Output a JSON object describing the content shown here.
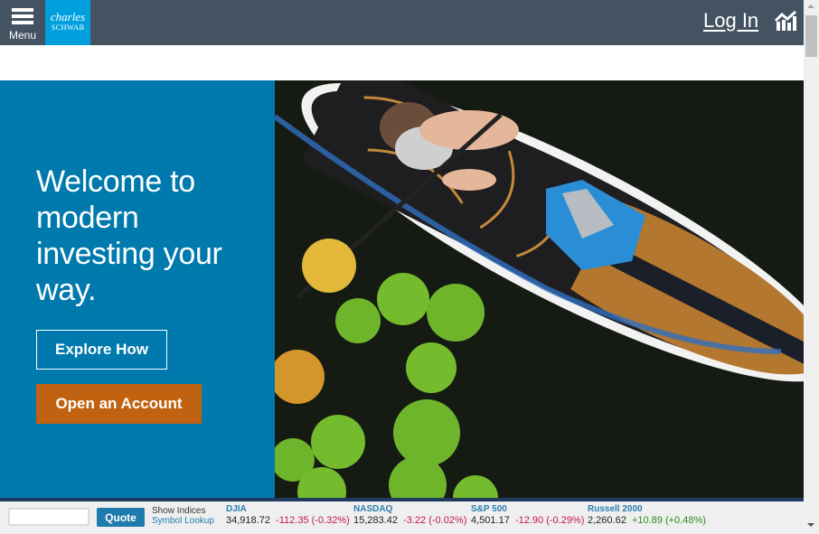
{
  "header": {
    "menu_label": "Menu",
    "logo_line1": "charles",
    "logo_line2": "SCHWAB",
    "login_label": "Log In",
    "chart_icon": "market-chart-icon"
  },
  "hero": {
    "title": "Welcome to modern investing your way.",
    "explore_label": "Explore How",
    "open_account_label": "Open an Account",
    "image_alt": "Aerial view of person kneeling on paddle board among lily pads"
  },
  "ticker": {
    "quote_input_value": "",
    "quote_label": "Quote",
    "show_indices_label": "Show Indices",
    "symbol_lookup_label": "Symbol Lookup",
    "indices": [
      {
        "name": "DJIA",
        "value": "34,918.72",
        "change": "-112.35 (-0.32%)",
        "direction": "neg"
      },
      {
        "name": "NASDAQ",
        "value": "15,283.42",
        "change": "-3.22 (-0.02%)",
        "direction": "neg"
      },
      {
        "name": "S&P 500",
        "value": "4,501.17",
        "change": "-12.90 (-0.29%)",
        "direction": "neg"
      },
      {
        "name": "Russell 2000",
        "value": "2,260.62",
        "change": "+10.89 (+0.48%)",
        "direction": "pos"
      }
    ]
  },
  "colors": {
    "header_bg": "#435362",
    "logo_bg": "#00a0df",
    "hero_bg": "#0079ac",
    "cta_orange": "#c0620f",
    "negative": "#c2184b",
    "positive": "#2e8b1e"
  }
}
